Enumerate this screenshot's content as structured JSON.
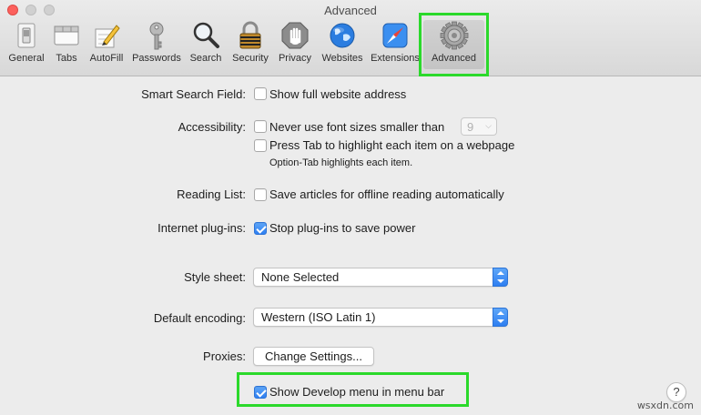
{
  "window": {
    "title": "Advanced"
  },
  "toolbar": {
    "items": [
      {
        "label": "General",
        "icon": "general-switch-icon"
      },
      {
        "label": "Tabs",
        "icon": "tabs-icon"
      },
      {
        "label": "AutoFill",
        "icon": "pencil-form-icon"
      },
      {
        "label": "Passwords",
        "icon": "key-icon"
      },
      {
        "label": "Search",
        "icon": "magnifier-icon"
      },
      {
        "label": "Security",
        "icon": "padlock-icon"
      },
      {
        "label": "Privacy",
        "icon": "hand-icon"
      },
      {
        "label": "Websites",
        "icon": "globe-icon"
      },
      {
        "label": "Extensions",
        "icon": "puzzle-compass-icon"
      },
      {
        "label": "Advanced",
        "icon": "gear-icon"
      }
    ],
    "selected": "Advanced"
  },
  "settings": {
    "smart_search": {
      "label": "Smart Search Field:",
      "option": "Show full website address",
      "checked": false
    },
    "accessibility": {
      "label": "Accessibility:",
      "option1": "Never use font sizes smaller than",
      "option1_checked": false,
      "font_size_value": "9",
      "option2": "Press Tab to highlight each item on a webpage",
      "option2_checked": false,
      "note": "Option-Tab highlights each item."
    },
    "reading_list": {
      "label": "Reading List:",
      "option": "Save articles for offline reading automatically",
      "checked": false
    },
    "plugins": {
      "label": "Internet plug-ins:",
      "option": "Stop plug-ins to save power",
      "checked": true
    },
    "style_sheet": {
      "label": "Style sheet:",
      "value": "None Selected"
    },
    "encoding": {
      "label": "Default encoding:",
      "value": "Western (ISO Latin 1)"
    },
    "proxies": {
      "label": "Proxies:",
      "button": "Change Settings..."
    },
    "develop": {
      "option": "Show Develop menu in menu bar",
      "checked": true
    }
  },
  "help": {
    "label": "?"
  },
  "watermark": "wsxdn.com",
  "colors": {
    "highlight": "#2bd92b",
    "accent": "#2e7ff1"
  }
}
